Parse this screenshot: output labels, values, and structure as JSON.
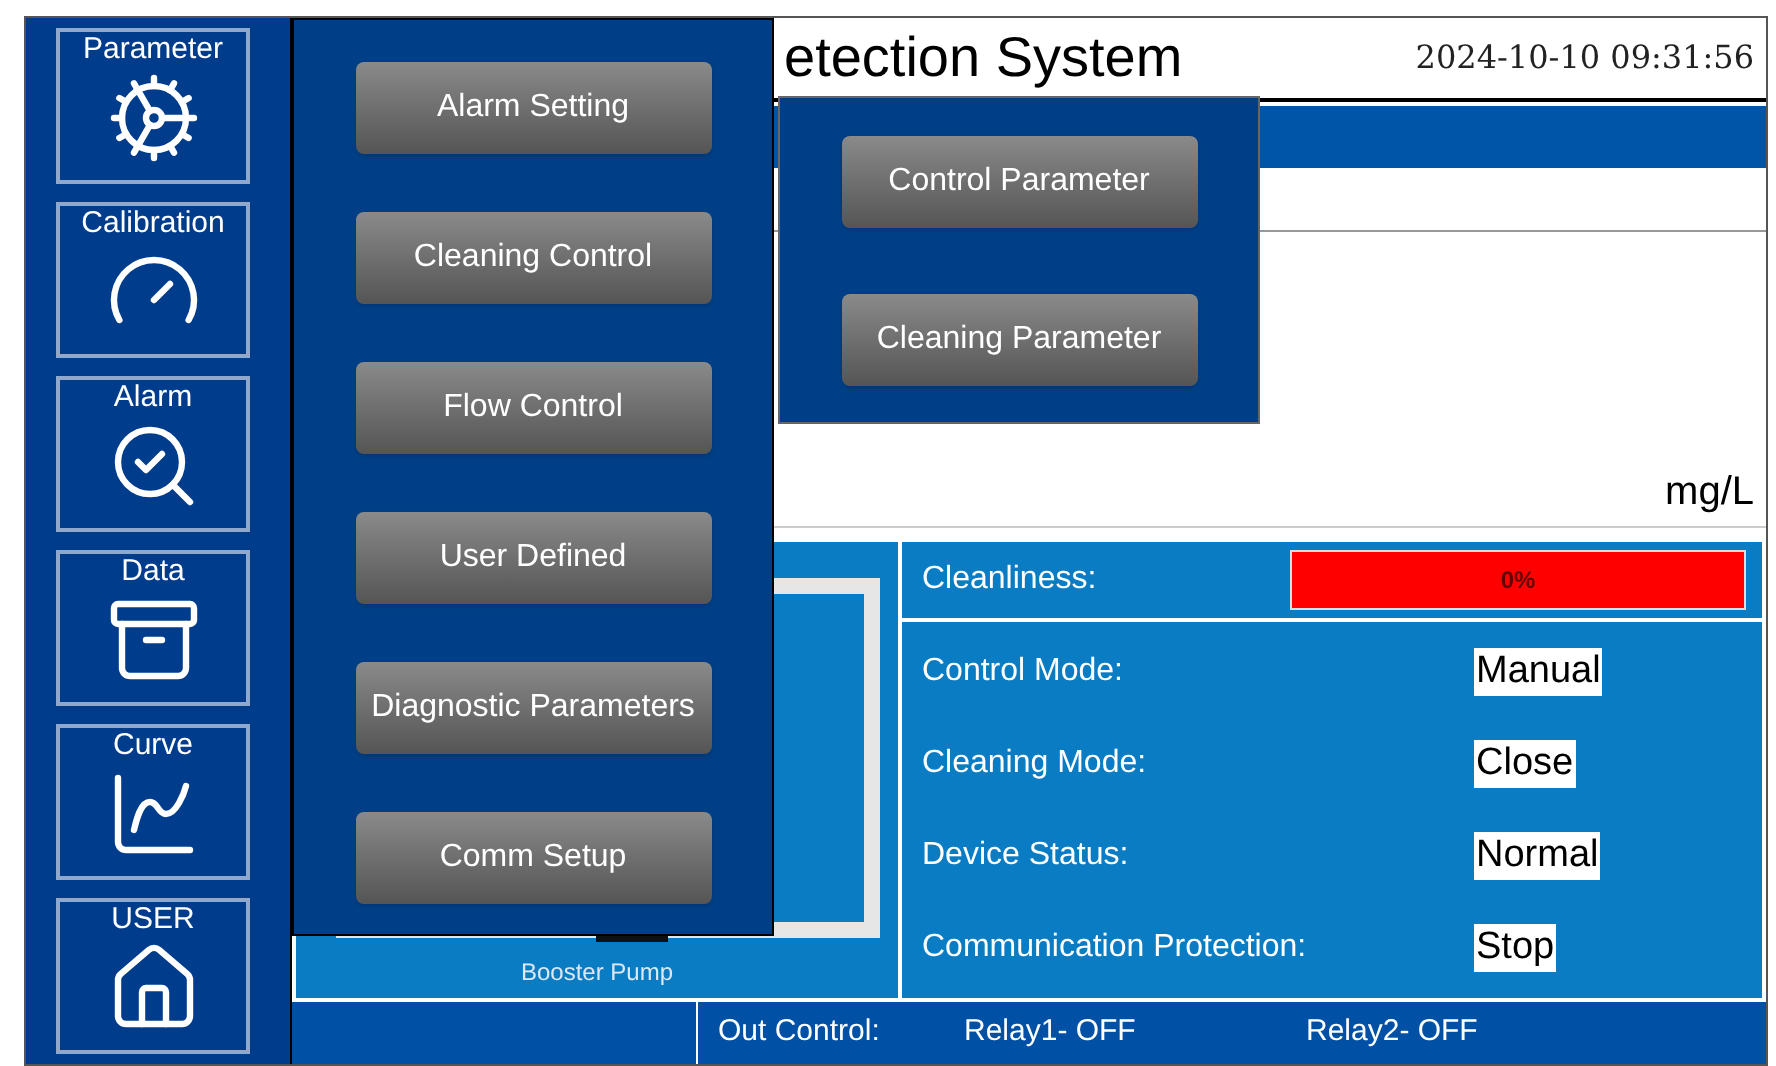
{
  "sidebar": {
    "items": [
      {
        "label": "Parameter"
      },
      {
        "label": "Calibration"
      },
      {
        "label": "Alarm"
      },
      {
        "label": "Data"
      },
      {
        "label": "Curve"
      },
      {
        "label": "USER"
      }
    ]
  },
  "header": {
    "title": "etection System",
    "datetime": "2024-10-10 09:31:56"
  },
  "reading": {
    "unit": "mg/L"
  },
  "pump": {
    "label": "Booster Pump"
  },
  "status": {
    "cleanliness": {
      "label": "Cleanliness:",
      "value": "0%"
    },
    "rows": [
      {
        "label": "Control Mode:",
        "value": "Manual"
      },
      {
        "label": "Cleaning Mode:",
        "value": "Close"
      },
      {
        "label": "Device Status:",
        "value": "Normal"
      },
      {
        "label": "Communication Protection:",
        "value": "Stop"
      }
    ]
  },
  "status_bar": {
    "label": "Out Control:",
    "relays": [
      "Relay1- OFF",
      "Relay2- OFF"
    ]
  },
  "menu": {
    "items": [
      "Alarm Setting",
      "Cleaning Control",
      "Flow Control",
      "User Defined",
      "Diagnostic Parameters",
      "Comm Setup"
    ]
  },
  "submenu": {
    "items": [
      "Control Parameter",
      "Cleaning Parameter"
    ]
  }
}
